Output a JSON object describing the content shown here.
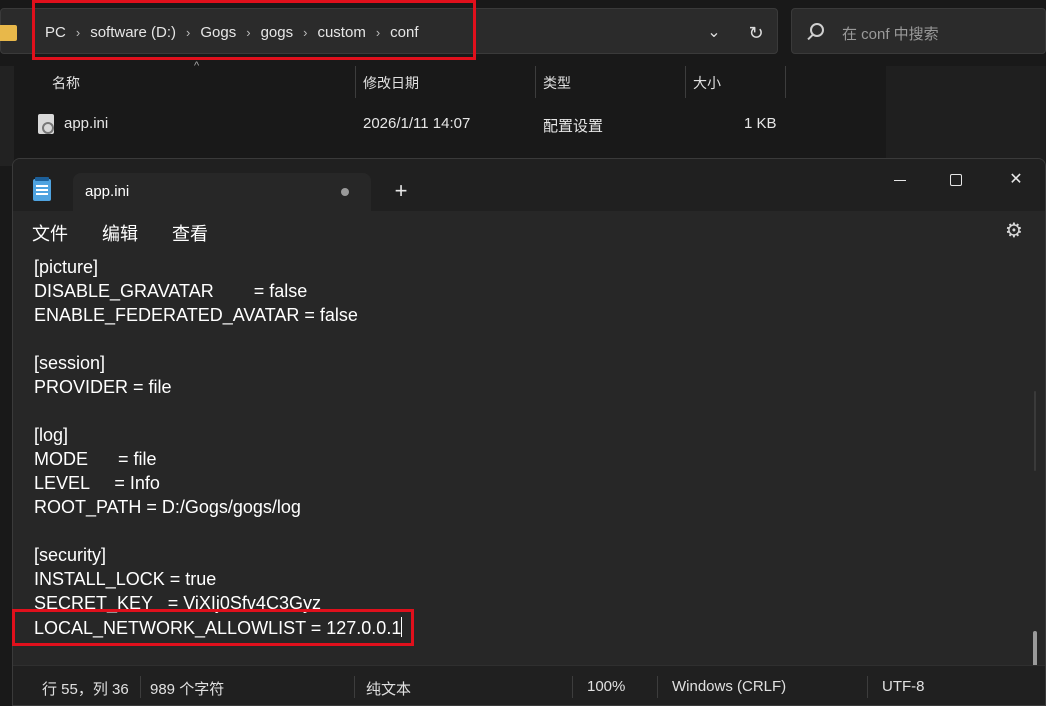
{
  "explorer": {
    "breadcrumbs": [
      "PC",
      "software (D:)",
      "Gogs",
      "gogs",
      "custom",
      "conf"
    ],
    "search_placeholder": "在 conf 中搜索",
    "columns": {
      "name": "名称",
      "modified": "修改日期",
      "type": "类型",
      "size": "大小"
    },
    "files": [
      {
        "name": "app.ini",
        "modified": "2026/1/11 14:07",
        "type": "配置设置",
        "size": "1 KB"
      }
    ]
  },
  "notepad": {
    "tab_title": "app.ini",
    "menu": {
      "file": "文件",
      "edit": "编辑",
      "view": "查看"
    },
    "window": {
      "minimize": "—",
      "maximize": "□",
      "close": "✕"
    },
    "lines": [
      "[picture]",
      "DISABLE_GRAVATAR        = false",
      "ENABLE_FEDERATED_AVATAR = false",
      "",
      "[session]",
      "PROVIDER = file",
      "",
      "[log]",
      "MODE      = file",
      "LEVEL     = Info",
      "ROOT_PATH = D:/Gogs/gogs/log",
      "",
      "[security]",
      "INSTALL_LOCK = true",
      "SECRET_KEY   = ViXIj0Sfv4C3Gyz",
      "LOCAL_NETWORK_ALLOWLIST = 127.0.0.1"
    ],
    "status": {
      "position": "行 55，列 36",
      "chars": "989 个字符",
      "format": "纯文本",
      "zoom": "100%",
      "line_ending": "Windows (CRLF)",
      "encoding": "UTF-8"
    }
  },
  "colors": {
    "highlight": "#e0101c",
    "notepad_bg": "#272727",
    "titlebar_bg": "#202020"
  }
}
